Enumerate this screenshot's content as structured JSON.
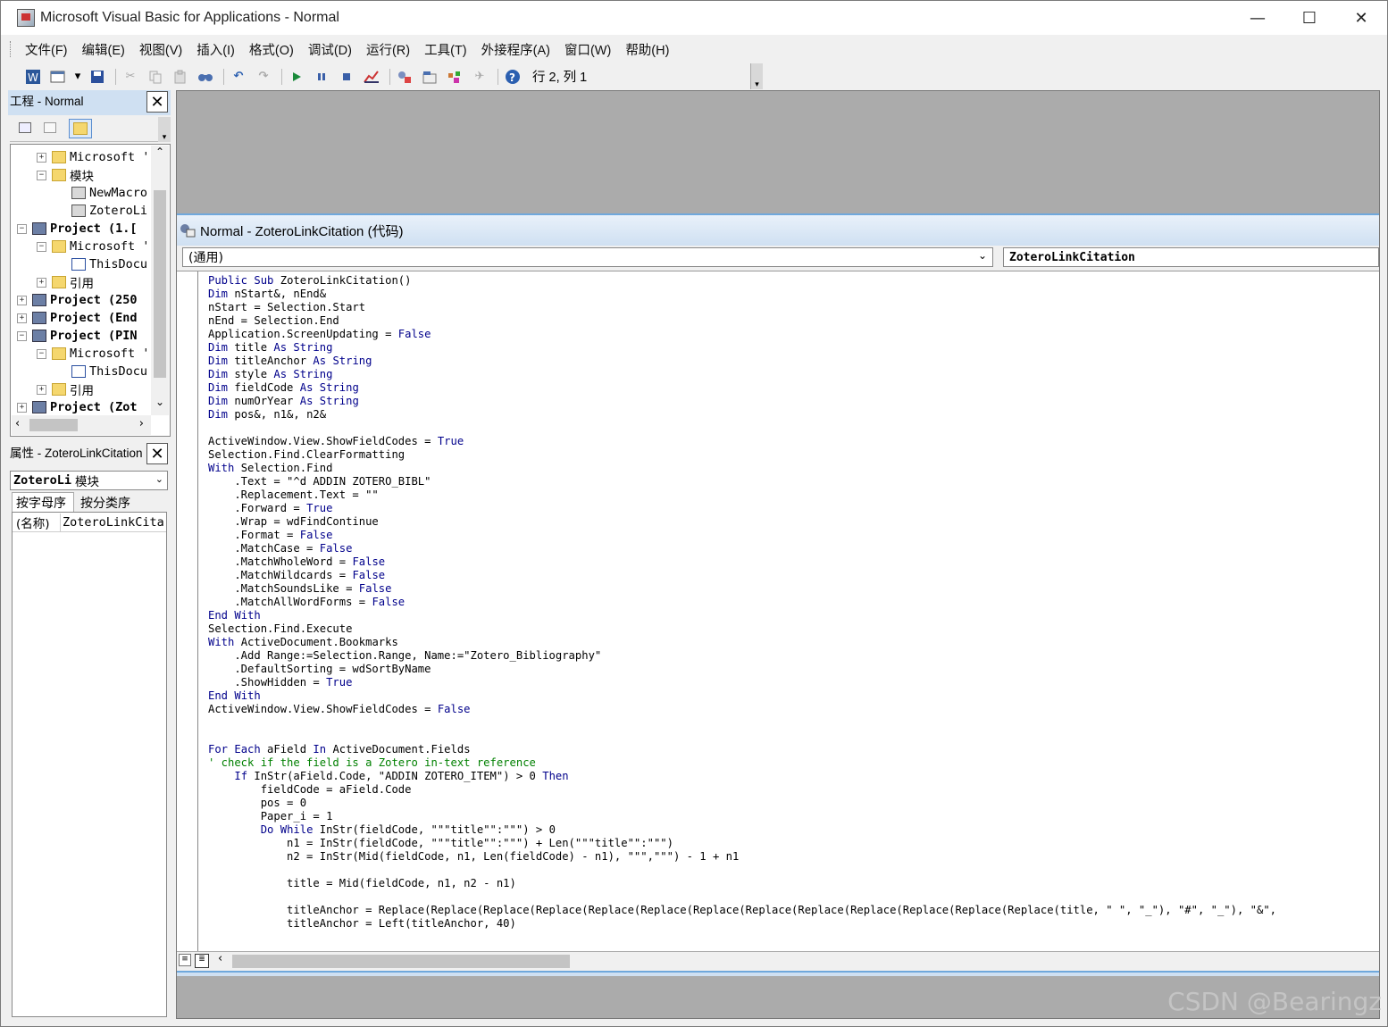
{
  "window": {
    "title": "Microsoft Visual Basic for Applications - Normal",
    "minimize": "—",
    "maximize": "☐",
    "close": "✕"
  },
  "menu": [
    "文件(F)",
    "编辑(E)",
    "视图(V)",
    "插入(I)",
    "格式(O)",
    "调试(D)",
    "运行(R)",
    "工具(T)",
    "外接程序(A)",
    "窗口(W)",
    "帮助(H)"
  ],
  "toolbar": {
    "position": "行 2, 列 1",
    "icons": [
      "word-icon",
      "insert-module-icon",
      "save-icon",
      "cut-icon",
      "copy-icon",
      "paste-icon",
      "find-icon",
      "undo-icon",
      "redo-icon",
      "run-icon",
      "break-icon",
      "reset-icon",
      "design-mode-icon",
      "project-explorer-icon",
      "properties-icon",
      "object-browser-icon",
      "toolbox-icon",
      "help-icon"
    ]
  },
  "project_pane": {
    "title": "工程 - Normal",
    "close": "✕",
    "tree": [
      {
        "label": "Microsoft '",
        "depth": 1,
        "expander": "+",
        "icon": "folder"
      },
      {
        "label": "模块",
        "depth": 1,
        "expander": "−",
        "icon": "folder"
      },
      {
        "label": "NewMacro",
        "depth": 2,
        "expander": "",
        "icon": "mod"
      },
      {
        "label": "ZoteroLi",
        "depth": 2,
        "expander": "",
        "icon": "mod"
      },
      {
        "label": "Project (1.[",
        "depth": 0,
        "expander": "−",
        "icon": "proj"
      },
      {
        "label": "Microsoft '",
        "depth": 1,
        "expander": "−",
        "icon": "folder"
      },
      {
        "label": "ThisDocu",
        "depth": 2,
        "expander": "",
        "icon": "doc"
      },
      {
        "label": "引用",
        "depth": 1,
        "expander": "+",
        "icon": "folder"
      },
      {
        "label": "Project (250",
        "depth": 0,
        "expander": "+",
        "icon": "proj"
      },
      {
        "label": "Project (End",
        "depth": 0,
        "expander": "+",
        "icon": "proj"
      },
      {
        "label": "Project (PIN",
        "depth": 0,
        "expander": "−",
        "icon": "proj"
      },
      {
        "label": "Microsoft '",
        "depth": 1,
        "expander": "−",
        "icon": "folder"
      },
      {
        "label": "ThisDocu",
        "depth": 2,
        "expander": "",
        "icon": "doc"
      },
      {
        "label": "引用",
        "depth": 1,
        "expander": "+",
        "icon": "folder"
      },
      {
        "label": "Project (Zot",
        "depth": 0,
        "expander": "+",
        "icon": "proj"
      }
    ]
  },
  "properties_pane": {
    "title": "属性 - ZoteroLinkCitation",
    "close": "✕",
    "object_name": "ZoteroLi",
    "object_type": "模块",
    "tab_alpha": "按字母序",
    "tab_category": "按分类序",
    "prop_name": "(名称)",
    "prop_value": "ZoteroLinkCita"
  },
  "code_window": {
    "title": "Normal - ZoteroLinkCitation (代码)",
    "object_combo": "(通用)",
    "proc_combo": "ZoteroLinkCitation",
    "lines": [
      "Public Sub ZoteroLinkCitation()",
      "Dim nStart&, nEnd&",
      "nStart = Selection.Start",
      "nEnd = Selection.End",
      "Application.ScreenUpdating = False",
      "Dim title As String",
      "Dim titleAnchor As String",
      "Dim style As String",
      "Dim fieldCode As String",
      "Dim numOrYear As String",
      "Dim pos&, n1&, n2&",
      "",
      "ActiveWindow.View.ShowFieldCodes = True",
      "Selection.Find.ClearFormatting",
      "With Selection.Find",
      "    .Text = \"^d ADDIN ZOTERO_BIBL\"",
      "    .Replacement.Text = \"\"",
      "    .Forward = True",
      "    .Wrap = wdFindContinue",
      "    .Format = False",
      "    .MatchCase = False",
      "    .MatchWholeWord = False",
      "    .MatchWildcards = False",
      "    .MatchSoundsLike = False",
      "    .MatchAllWordForms = False",
      "End With",
      "Selection.Find.Execute",
      "With ActiveDocument.Bookmarks",
      "    .Add Range:=Selection.Range, Name:=\"Zotero_Bibliography\"",
      "    .DefaultSorting = wdSortByName",
      "    .ShowHidden = True",
      "End With",
      "ActiveWindow.View.ShowFieldCodes = False",
      "",
      "",
      "For Each aField In ActiveDocument.Fields",
      "' check if the field is a Zotero in-text reference",
      "    If InStr(aField.Code, \"ADDIN ZOTERO_ITEM\") > 0 Then",
      "        fieldCode = aField.Code",
      "        pos = 0",
      "        Paper_i = 1",
      "        Do While InStr(fieldCode, \"\"\"title\"\":\"\"\") > 0",
      "            n1 = InStr(fieldCode, \"\"\"title\"\":\"\"\") + Len(\"\"\"title\"\":\"\"\")",
      "            n2 = InStr(Mid(fieldCode, n1, Len(fieldCode) - n1), \"\"\",\"\"\") - 1 + n1",
      "",
      "            title = Mid(fieldCode, n1, n2 - n1)",
      "",
      "            titleAnchor = Replace(Replace(Replace(Replace(Replace(Replace(Replace(Replace(Replace(Replace(Replace(Replace(Replace(title, \" \", \"_\"), \"#\", \"_\"), \"&\",",
      "            titleAnchor = Left(titleAnchor, 40)"
    ]
  },
  "watermark": "CSDN @Bearingz"
}
